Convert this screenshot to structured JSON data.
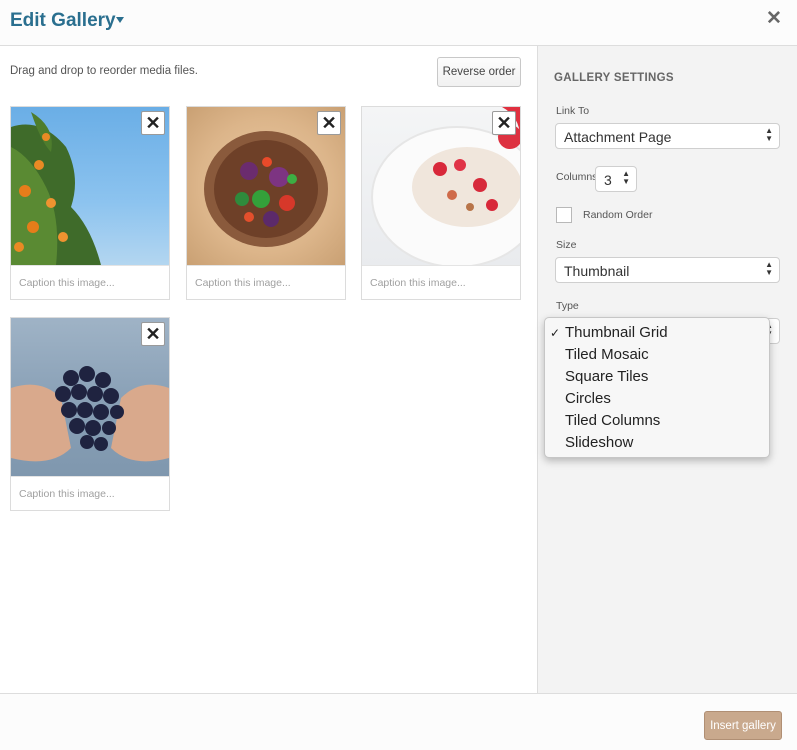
{
  "header": {
    "title": "Edit Gallery",
    "close_icon": "close-icon"
  },
  "main": {
    "instructions": "Drag and drop to reorder media files.",
    "reverse_button": "Reverse order",
    "tiles": [
      {
        "caption_placeholder": "Caption this image...",
        "image": "orange tree"
      },
      {
        "caption_placeholder": "Caption this image...",
        "image": "salad bowl"
      },
      {
        "caption_placeholder": "Caption this image...",
        "image": "yogurt with strawberries"
      },
      {
        "caption_placeholder": "Caption this image...",
        "image": "hands holding grapes"
      }
    ]
  },
  "sidebar": {
    "title": "GALLERY SETTINGS",
    "link_to": {
      "label": "Link To",
      "value": "Attachment Page"
    },
    "columns": {
      "label": "Columns",
      "value": "3"
    },
    "random_order": {
      "label": "Random Order",
      "checked": false
    },
    "size": {
      "label": "Size",
      "value": "Thumbnail"
    },
    "type": {
      "label": "Type",
      "options": [
        "Thumbnail Grid",
        "Tiled Mosaic",
        "Square Tiles",
        "Circles",
        "Tiled Columns",
        "Slideshow"
      ],
      "selected": "Thumbnail Grid",
      "check_mark": "✓"
    }
  },
  "footer": {
    "insert_button": "Insert gallery"
  },
  "colors": {
    "title": "#2a6f8f",
    "insert_button_bg": "#c9a98d"
  }
}
